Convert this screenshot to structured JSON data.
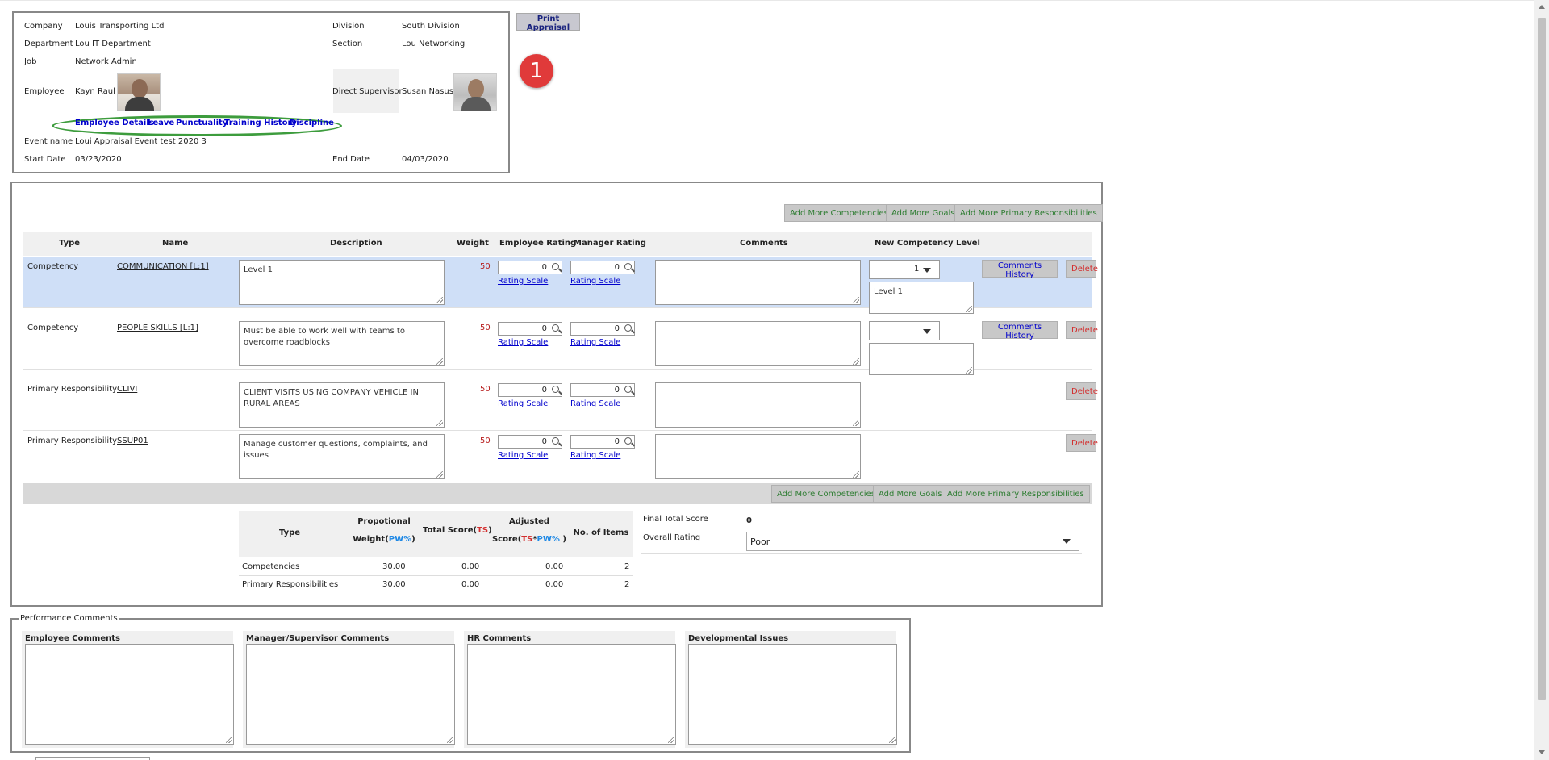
{
  "info": {
    "company_label": "Company",
    "company": "Louis Transporting Ltd",
    "department_label": "Department",
    "department": "Lou IT Department",
    "job_label": "Job",
    "job": "Network Admin",
    "employee_label": "Employee",
    "employee": "Kayn Raul",
    "division_label": "Division",
    "division": "South Division",
    "section_label": "Section",
    "section": "Lou Networking",
    "supervisor_label": "Direct Supervisor",
    "supervisor": "Susan Nasus",
    "event_label": "Event name",
    "event": "Loui Appraisal Event test 2020 3",
    "start_label": "Start Date",
    "start": "03/23/2020",
    "end_label": "End Date",
    "end": "04/03/2020",
    "links": [
      "Employee Details",
      "Leave",
      "Punctuality",
      "Training History",
      "Discipline"
    ]
  },
  "print_label": "Print Appraisal",
  "badge": "1",
  "buttons": {
    "add_competencies": "Add More Competencies",
    "add_goals": "Add More Goals",
    "add_primary": "Add More Primary Responsibilities",
    "comments_history": "Comments History",
    "delete": "Delete",
    "rating_scale": "Rating Scale"
  },
  "table": {
    "headers": [
      "Type",
      "Name",
      "Description",
      "Weight",
      "Employee Rating",
      "Manager Rating",
      "Comments",
      "New Competency Level"
    ],
    "rows": [
      {
        "type": "Competency",
        "name": "COMMUNICATION [L:1]",
        "description": "Level 1",
        "weight": "50",
        "emp": "0",
        "mgr": "0",
        "level": "1",
        "level_desc": "Level 1"
      },
      {
        "type": "Competency",
        "name": "PEOPLE SKILLS [L:1]",
        "description": "Must be able to work well with teams to overcome roadblocks",
        "weight": "50",
        "emp": "0",
        "mgr": "0",
        "level": "",
        "level_desc": ""
      },
      {
        "type": "Primary Responsibility",
        "name": "CLIVI",
        "description": "CLIENT VISITS USING COMPANY VEHICLE IN RURAL AREAS",
        "weight": "50",
        "emp": "0",
        "mgr": "0"
      },
      {
        "type": "Primary Responsibility",
        "name": "SSUP01",
        "description": "Manage customer questions, complaints, and issues",
        "weight": "50",
        "emp": "0",
        "mgr": "0"
      }
    ]
  },
  "summary": {
    "h_type": "Type",
    "h_prop1": "Propotional",
    "h_prop2": "Weight(",
    "h_pw": "PW%",
    "h_close": ")",
    "h_ts1": "Total Score(",
    "h_ts": "TS",
    "h_adj1": "Adjusted",
    "h_adj2": "Score(",
    "h_star": "*",
    "h_adjclose": " )",
    "h_items": "No. of Items",
    "rows": [
      {
        "type": "Competencies",
        "weight": "30.00",
        "total": "0.00",
        "adjusted": "0.00",
        "items": "2"
      },
      {
        "type": "Primary Responsibilities",
        "weight": "30.00",
        "total": "0.00",
        "adjusted": "0.00",
        "items": "2"
      }
    ],
    "final_label": "Final Total Score",
    "final_value": "0",
    "overall_label": "Overall Rating",
    "overall_value": "Poor"
  },
  "perf": {
    "legend": "Performance Comments",
    "cols": [
      "Employee Comments",
      "Manager/Supervisor Comments",
      "HR Comments",
      "Developmental Issues"
    ]
  }
}
